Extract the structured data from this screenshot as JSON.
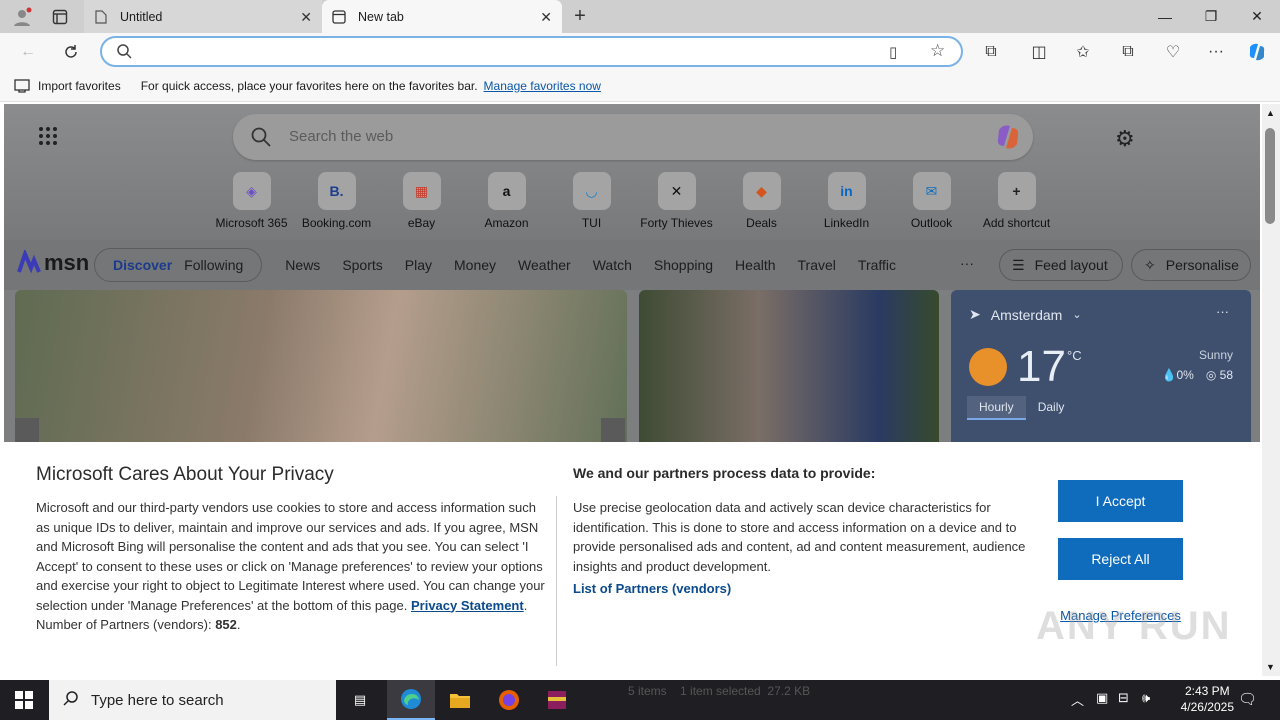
{
  "tabs": [
    {
      "title": "Untitled"
    },
    {
      "title": "New tab"
    }
  ],
  "address": {
    "value": "",
    "placeholder": ""
  },
  "favorites_bar": {
    "import_label": "Import favorites",
    "message": "For quick access, place your favorites here on the favorites bar.",
    "link": "Manage favorites now"
  },
  "newtab": {
    "search_placeholder": "Search the web",
    "shortcuts": [
      {
        "label": "Microsoft 365",
        "glyph": "◈",
        "color": "#6a4fc8"
      },
      {
        "label": "Booking.com",
        "glyph": "B.",
        "color": "#1d3d8f"
      },
      {
        "label": "eBay",
        "glyph": "▦",
        "color": "#c43c2c"
      },
      {
        "label": "Amazon",
        "glyph": "a",
        "color": "#111"
      },
      {
        "label": "TUI",
        "glyph": "◡",
        "color": "#1f7fc7"
      },
      {
        "label": "Forty Thieves",
        "glyph": "✕",
        "color": "#111"
      },
      {
        "label": "Deals",
        "glyph": "◆",
        "color": "#d3541c"
      },
      {
        "label": "LinkedIn",
        "glyph": "in",
        "color": "#0a66c2"
      },
      {
        "label": "Outlook",
        "glyph": "✉",
        "color": "#0f6cbd"
      },
      {
        "label": "Add shortcut",
        "glyph": "+",
        "color": "#222"
      }
    ],
    "msn": {
      "logo": "msn",
      "pill": [
        "Discover",
        "Following"
      ],
      "nav": [
        "News",
        "Sports",
        "Play",
        "Money",
        "Weather",
        "Watch",
        "Shopping",
        "Health",
        "Travel",
        "Traffic"
      ],
      "more": "···",
      "feed_layout": "Feed layout",
      "personalise": "Personalise"
    },
    "weather": {
      "location": "Amsterdam",
      "temp": "17",
      "unit": "°C",
      "condition": "Sunny",
      "precip": "0%",
      "aqi": "58",
      "tabs": [
        "Hourly",
        "Daily"
      ]
    }
  },
  "privacy": {
    "title": "Microsoft Cares About Your Privacy",
    "body": "Microsoft and our third-party vendors use cookies to store and access information such as unique IDs to deliver, maintain and improve our services and ads. If you agree, MSN and Microsoft Bing will personalise the content and ads that you see. You can select 'I Accept' to consent to these uses or click on 'Manage preferences' to review your options and exercise your right to object to Legitimate Interest where used.  You can change your selection under 'Manage Preferences' at the bottom of this page.",
    "privacy_link": "Privacy Statement",
    "partners_label": "Number of Partners (vendors):",
    "partners_count": "852",
    "right_title": "We and our partners process data to provide:",
    "right_body": "Use precise geolocation data and actively scan device characteristics for identification. This is done to store and access information on a device and to provide personalised ads and content, ad and content measurement, audience insights and product development.",
    "partners_link": "List of Partners (vendors)",
    "accept": "I Accept",
    "reject": "Reject All",
    "manage": "Manage Preferences"
  },
  "taskbar": {
    "search_placeholder": "Type here to search",
    "time": "2:43 PM",
    "date": "4/26/2025",
    "explorer_status": "5 items    1 item selected  27.2 KB"
  },
  "watermark": "ANY RUN"
}
